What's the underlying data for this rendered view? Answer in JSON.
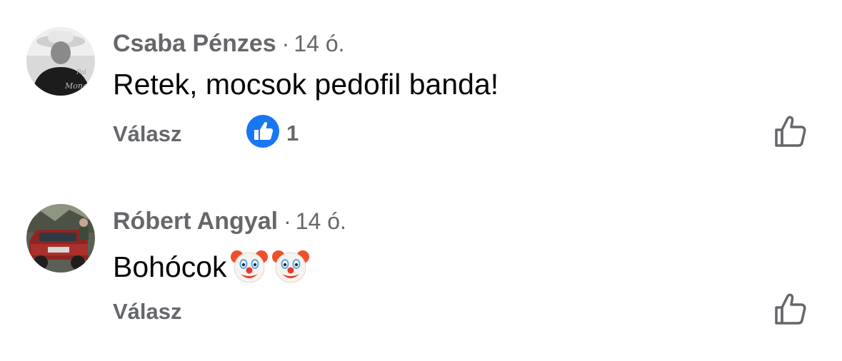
{
  "comments": [
    {
      "author": "Csaba Pénzes",
      "separator": "·",
      "time": "14 ó.",
      "text": "Retek, mocsok pedofil banda!",
      "reply_label": "Válasz",
      "reaction": {
        "icon": "like-reaction-icon",
        "count": "1",
        "color": "#1877f2"
      },
      "like_icon": "thumbs-up-outline-icon"
    },
    {
      "author": "Róbert Angyal",
      "separator": "·",
      "time": "14 ó.",
      "text": "Bohócok",
      "emojis": [
        "clown-face-emoji",
        "clown-face-emoji"
      ],
      "reply_label": "Válasz",
      "like_icon": "thumbs-up-outline-icon"
    }
  ],
  "colors": {
    "secondary_text": "#65676b",
    "primary_text": "#050505",
    "like_blue": "#1877f2"
  }
}
